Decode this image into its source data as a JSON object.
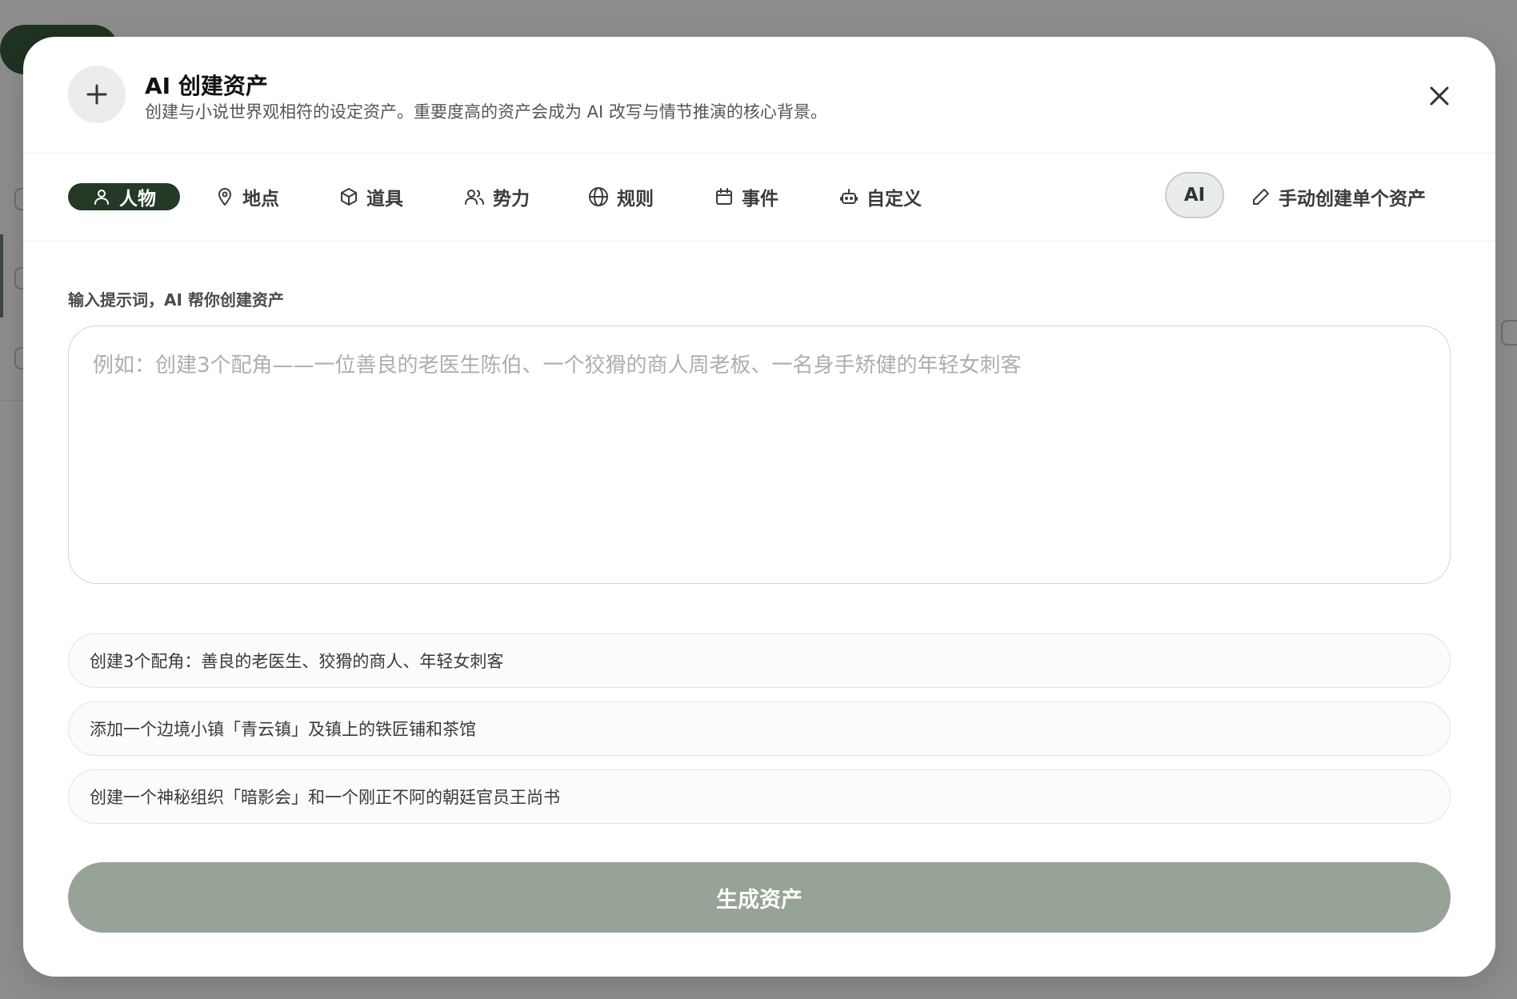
{
  "dialog": {
    "title": "AI 创建资产",
    "subtitle": "创建与小说世界观相符的设定资产。重要度高的资产会成为 AI 改写与情节推演的核心背景。"
  },
  "tabs": [
    {
      "label": "人物",
      "icon": "user-icon",
      "active": true
    },
    {
      "label": "地点",
      "icon": "map-pin-icon",
      "active": false
    },
    {
      "label": "道具",
      "icon": "box-icon",
      "active": false
    },
    {
      "label": "势力",
      "icon": "users-icon",
      "active": false
    },
    {
      "label": "规则",
      "icon": "globe-icon",
      "active": false
    },
    {
      "label": "事件",
      "icon": "calendar-icon",
      "active": false
    },
    {
      "label": "自定义",
      "icon": "bot-icon",
      "active": false
    }
  ],
  "mode": {
    "ai_label": "AI",
    "manual_label": "手动创建单个资产"
  },
  "prompt": {
    "label": "输入提示词，AI 帮你创建资产",
    "placeholder": "例如：创建3个配角——一位善良的老医生陈伯、一个狡猾的商人周老板、一名身手矫健的年轻女刺客",
    "value": ""
  },
  "suggestions": [
    "创建3个配角：善良的老医生、狡猾的商人、年轻女刺客",
    "添加一个边境小镇「青云镇」及镇上的铁匠铺和茶馆",
    "创建一个神秘组织「暗影会」和一个刚正不阿的朝廷官员王尚书"
  ],
  "generate_label": "生成资产",
  "colors": {
    "accent_dark": "#243926",
    "generate_button": "#97a396",
    "backdrop": "#8d8d8d"
  }
}
